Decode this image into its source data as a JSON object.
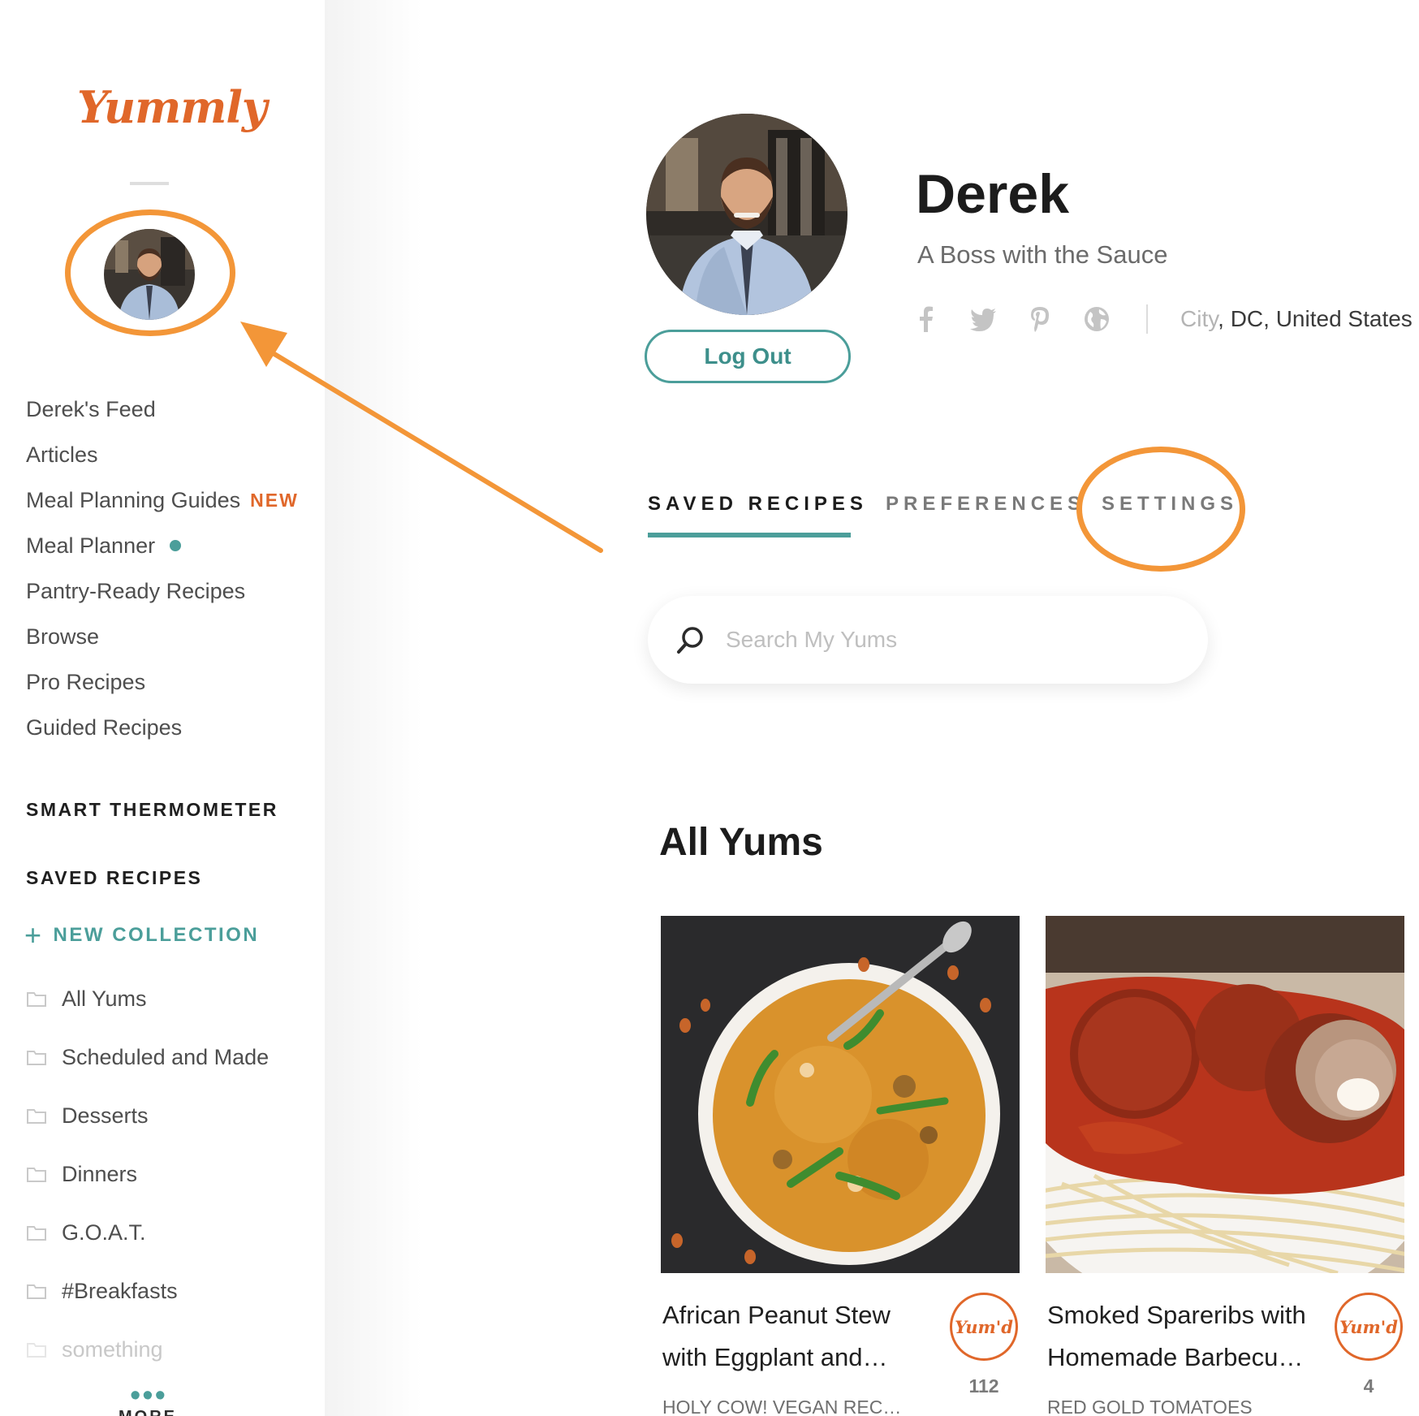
{
  "brand": {
    "logo_text": "Yummly",
    "accent": "#e0672a",
    "teal": "#4b9e9a",
    "annotation": "#f39638"
  },
  "sidebar": {
    "nav": [
      {
        "label": "Derek's Feed"
      },
      {
        "label": "Articles"
      },
      {
        "label": "Meal Planning Guides",
        "badge": "NEW"
      },
      {
        "label": "Meal Planner",
        "indicator": "dot"
      },
      {
        "label": "Pantry-Ready Recipes"
      },
      {
        "label": "Browse"
      },
      {
        "label": "Pro Recipes"
      },
      {
        "label": "Guided Recipes"
      }
    ],
    "smart_thermometer": "SMART THERMOMETER",
    "saved_recipes": "SAVED RECIPES",
    "new_collection": "NEW COLLECTION",
    "collections": [
      {
        "label": "All Yums"
      },
      {
        "label": "Scheduled and Made"
      },
      {
        "label": "Desserts"
      },
      {
        "label": "Dinners"
      },
      {
        "label": "G.O.A.T."
      },
      {
        "label": "#Breakfasts"
      },
      {
        "label": "something"
      }
    ],
    "more": "MORE"
  },
  "profile": {
    "name": "Derek",
    "tagline": "A Boss with the Sauce",
    "logout": "Log Out",
    "location_city": "City",
    "location_rest": ", DC, United States",
    "social_icons": [
      "facebook-icon",
      "twitter-icon",
      "pinterest-icon",
      "website-globe-icon"
    ]
  },
  "tabs": [
    {
      "label": "SAVED RECIPES",
      "active": true
    },
    {
      "label": "PREFERENCES",
      "active": false
    },
    {
      "label": "SETTINGS",
      "active": false
    }
  ],
  "search": {
    "placeholder": "Search My Yums"
  },
  "all_yums": {
    "title": "All Yums",
    "cards": [
      {
        "title": "African Peanut Stew with Eggplant and…",
        "source": "HOLY COW! VEGAN REC…",
        "badge": "Yum'd",
        "count": "112"
      },
      {
        "title": "Smoked Spareribs with Homemade Barbecu…",
        "source": "RED GOLD TOMATOES",
        "badge": "Yum'd",
        "count": "4"
      }
    ]
  }
}
